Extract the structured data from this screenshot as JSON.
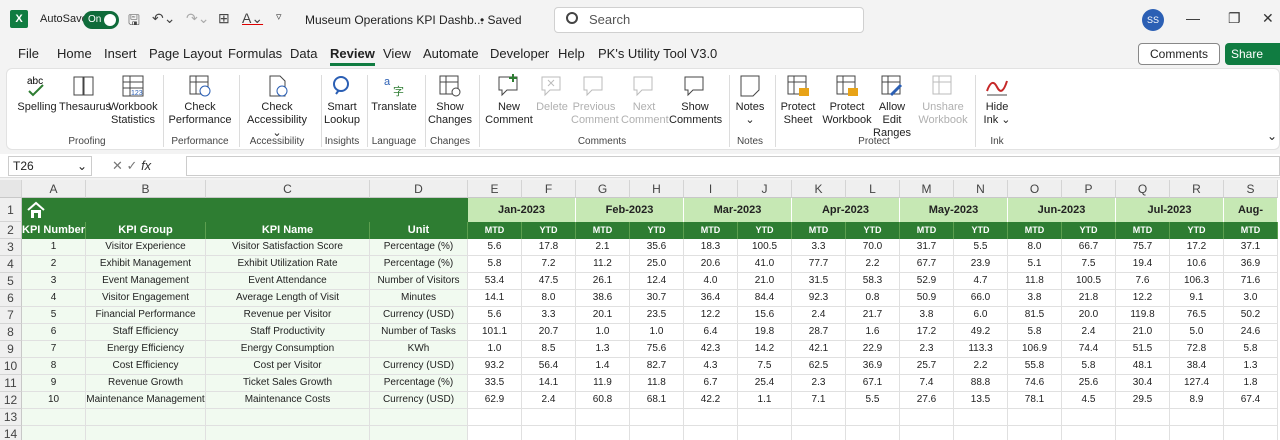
{
  "titlebar": {
    "autosave_label": "AutoSave",
    "toggle_label": "On",
    "doc_title": "Museum Operations KPI Dashb...",
    "saved_label": "• Saved",
    "search_placeholder": "Search",
    "avatar_initials": "SS"
  },
  "menu": {
    "items": [
      "File",
      "Home",
      "Insert",
      "Page Layout",
      "Formulas",
      "Data",
      "Review",
      "View",
      "Automate",
      "Developer",
      "Help",
      "PK's Utility Tool V3.0"
    ],
    "active": "Review",
    "comments_label": "Comments",
    "share_label": "Share"
  },
  "ribbon": {
    "buttons": {
      "spelling": "Spelling",
      "thesaurus": "Thesaurus",
      "workbook_stats_1": "Workbook",
      "workbook_stats_2": "Statistics",
      "check_perf_1": "Check",
      "check_perf_2": "Performance",
      "check_acc_1": "Check",
      "check_acc_2": "Accessibility",
      "smart_1": "Smart",
      "smart_2": "Lookup",
      "translate": "Translate",
      "show_changes_1": "Show",
      "show_changes_2": "Changes",
      "new_comment_1": "New",
      "new_comment_2": "Comment",
      "delete": "Delete",
      "prev_comment_1": "Previous",
      "prev_comment_2": "Comment",
      "next_comment_1": "Next",
      "next_comment_2": "Comment",
      "show_comments_1": "Show",
      "show_comments_2": "Comments",
      "notes": "Notes",
      "protect_sheet_1": "Protect",
      "protect_sheet_2": "Sheet",
      "protect_wb_1": "Protect",
      "protect_wb_2": "Workbook",
      "allow_edit_1": "Allow Edit",
      "allow_edit_2": "Ranges",
      "unshare_1": "Unshare",
      "unshare_2": "Workbook",
      "hide_ink_1": "Hide",
      "hide_ink_2": "Ink"
    },
    "groups": {
      "proofing": "Proofing",
      "performance": "Performance",
      "accessibility": "Accessibility",
      "insights": "Insights",
      "language": "Language",
      "changes": "Changes",
      "comments": "Comments",
      "notes": "Notes",
      "protect": "Protect",
      "ink": "Ink"
    }
  },
  "formula_bar": {
    "name_box": "T26",
    "fx": "fx",
    "formula": ""
  },
  "sheet": {
    "col_letters": [
      "A",
      "B",
      "C",
      "D",
      "E",
      "F",
      "G",
      "H",
      "I",
      "J",
      "K",
      "L",
      "M",
      "N",
      "O",
      "P",
      "Q",
      "R",
      "S"
    ],
    "row_numbers": [
      "1",
      "2",
      "3",
      "4",
      "5",
      "6",
      "7",
      "8",
      "9",
      "10",
      "11",
      "12",
      "13",
      "14"
    ],
    "months": [
      "Jan-2023",
      "Feb-2023",
      "Mar-2023",
      "Apr-2023",
      "May-2023",
      "Jun-2023",
      "Jul-2023",
      "Aug-"
    ],
    "headers": [
      "KPI Number",
      "KPI Group",
      "KPI Name",
      "Unit"
    ],
    "sub_headers": [
      "MTD",
      "YTD"
    ],
    "rows": [
      [
        "1",
        "Visitor Experience",
        "Visitor Satisfaction Score",
        "Percentage (%)",
        "5.6",
        "17.8",
        "2.1",
        "35.6",
        "18.3",
        "100.5",
        "3.3",
        "70.0",
        "31.7",
        "5.5",
        "8.0",
        "66.7",
        "75.7",
        "17.2",
        "37.1"
      ],
      [
        "2",
        "Exhibit Management",
        "Exhibit Utilization Rate",
        "Percentage (%)",
        "5.8",
        "7.2",
        "11.2",
        "25.0",
        "20.6",
        "41.0",
        "77.7",
        "2.2",
        "67.7",
        "23.9",
        "5.1",
        "7.5",
        "19.4",
        "10.6",
        "36.9"
      ],
      [
        "3",
        "Event Management",
        "Event Attendance",
        "Number of Visitors",
        "53.4",
        "47.5",
        "26.1",
        "12.4",
        "4.0",
        "21.0",
        "31.5",
        "58.3",
        "52.9",
        "4.7",
        "11.8",
        "100.5",
        "7.6",
        "106.3",
        "71.6"
      ],
      [
        "4",
        "Visitor Engagement",
        "Average Length of Visit",
        "Minutes",
        "14.1",
        "8.0",
        "38.6",
        "30.7",
        "36.4",
        "84.4",
        "92.3",
        "0.8",
        "50.9",
        "66.0",
        "3.8",
        "21.8",
        "12.2",
        "9.1",
        "3.0"
      ],
      [
        "5",
        "Financial Performance",
        "Revenue per Visitor",
        "Currency (USD)",
        "5.6",
        "3.3",
        "20.1",
        "23.5",
        "12.2",
        "15.6",
        "2.4",
        "21.7",
        "3.8",
        "6.0",
        "81.5",
        "20.0",
        "119.8",
        "76.5",
        "50.2"
      ],
      [
        "6",
        "Staff Efficiency",
        "Staff Productivity",
        "Number of Tasks",
        "101.1",
        "20.7",
        "1.0",
        "1.0",
        "6.4",
        "19.8",
        "28.7",
        "1.6",
        "17.2",
        "49.2",
        "5.8",
        "2.4",
        "21.0",
        "5.0",
        "24.6"
      ],
      [
        "7",
        "Energy Efficiency",
        "Energy Consumption",
        "KWh",
        "1.0",
        "8.5",
        "1.3",
        "75.6",
        "42.3",
        "14.2",
        "42.1",
        "22.9",
        "2.3",
        "113.3",
        "106.9",
        "74.4",
        "51.5",
        "72.8",
        "5.8"
      ],
      [
        "8",
        "Cost Efficiency",
        "Cost per Visitor",
        "Currency (USD)",
        "93.2",
        "56.4",
        "1.4",
        "82.7",
        "4.3",
        "7.5",
        "62.5",
        "36.9",
        "25.7",
        "2.2",
        "55.8",
        "5.8",
        "48.1",
        "38.4",
        "1.3"
      ],
      [
        "9",
        "Revenue Growth",
        "Ticket Sales Growth",
        "Percentage (%)",
        "33.5",
        "14.1",
        "11.9",
        "11.8",
        "6.7",
        "25.4",
        "2.3",
        "67.1",
        "7.4",
        "88.8",
        "74.6",
        "25.6",
        "30.4",
        "127.4",
        "1.8"
      ],
      [
        "10",
        "Maintenance Management",
        "Maintenance Costs",
        "Currency (USD)",
        "62.9",
        "2.4",
        "60.8",
        "68.1",
        "42.2",
        "1.1",
        "7.1",
        "5.5",
        "27.6",
        "13.5",
        "78.1",
        "4.5",
        "29.5",
        "8.9",
        "67.4"
      ]
    ]
  },
  "colors": {
    "excel_green": "#107c41",
    "header_green": "#2e7d32",
    "month_light_green": "#c6e8b4"
  }
}
